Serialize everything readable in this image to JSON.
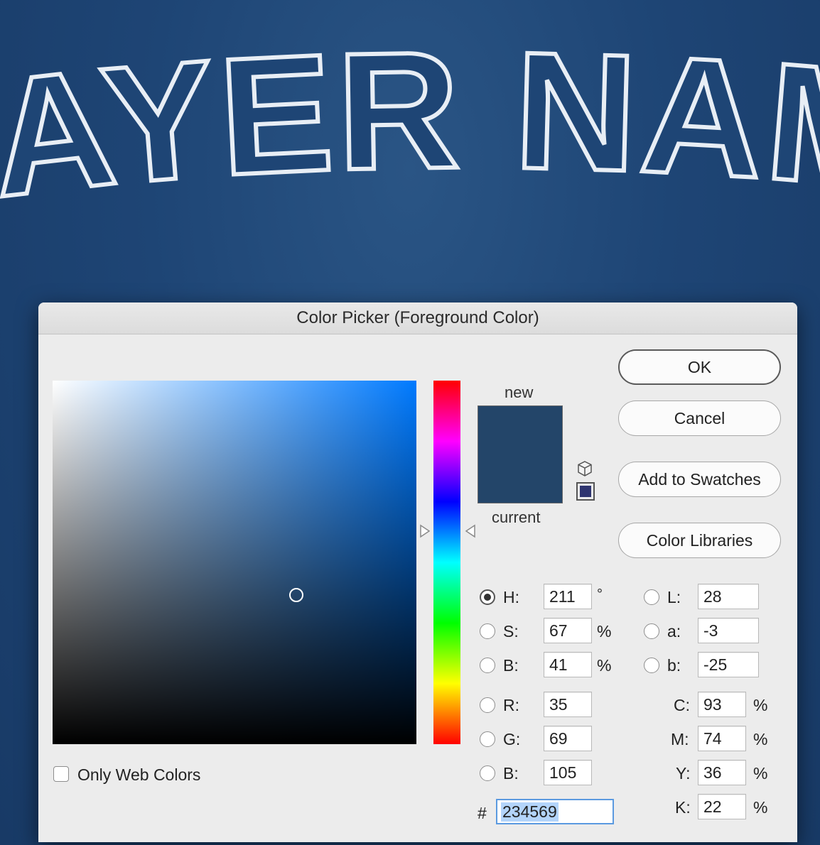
{
  "background": {
    "artwork_text": "LAYER NAM",
    "colors": {
      "jersey": "#1e4575",
      "outline": "#e8eef5"
    }
  },
  "dialog": {
    "title": "Color Picker (Foreground Color)",
    "buttons": {
      "ok": "OK",
      "cancel": "Cancel",
      "add_to_swatches": "Add to Swatches",
      "color_libraries": "Color Libraries"
    },
    "preview": {
      "new_label": "new",
      "current_label": "current",
      "new_color": "#234569",
      "current_color": "#234569",
      "gamut_icon": "cube-icon",
      "web_swatch_color": "#2f3570"
    },
    "only_web_colors": {
      "label": "Only Web Colors",
      "checked": false
    },
    "hsb": {
      "h": {
        "label": "H:",
        "value": "211",
        "unit": "°",
        "selected": true
      },
      "s": {
        "label": "S:",
        "value": "67",
        "unit": "%"
      },
      "b": {
        "label": "B:",
        "value": "41",
        "unit": "%"
      }
    },
    "rgb": {
      "r": {
        "label": "R:",
        "value": "35"
      },
      "g": {
        "label": "G:",
        "value": "69"
      },
      "b": {
        "label": "B:",
        "value": "105"
      }
    },
    "lab": {
      "l": {
        "label": "L:",
        "value": "28"
      },
      "a": {
        "label": "a:",
        "value": "-3"
      },
      "b": {
        "label": "b:",
        "value": "-25"
      }
    },
    "cmyk": {
      "c": {
        "label": "C:",
        "value": "93",
        "unit": "%"
      },
      "m": {
        "label": "M:",
        "value": "74",
        "unit": "%"
      },
      "y": {
        "label": "Y:",
        "value": "36",
        "unit": "%"
      },
      "k": {
        "label": "K:",
        "value": "22",
        "unit": "%"
      }
    },
    "hex": {
      "label": "#",
      "value": "234569"
    },
    "picker": {
      "hue_degrees": 211,
      "saturation_pct": 67,
      "brightness_pct": 41
    }
  }
}
